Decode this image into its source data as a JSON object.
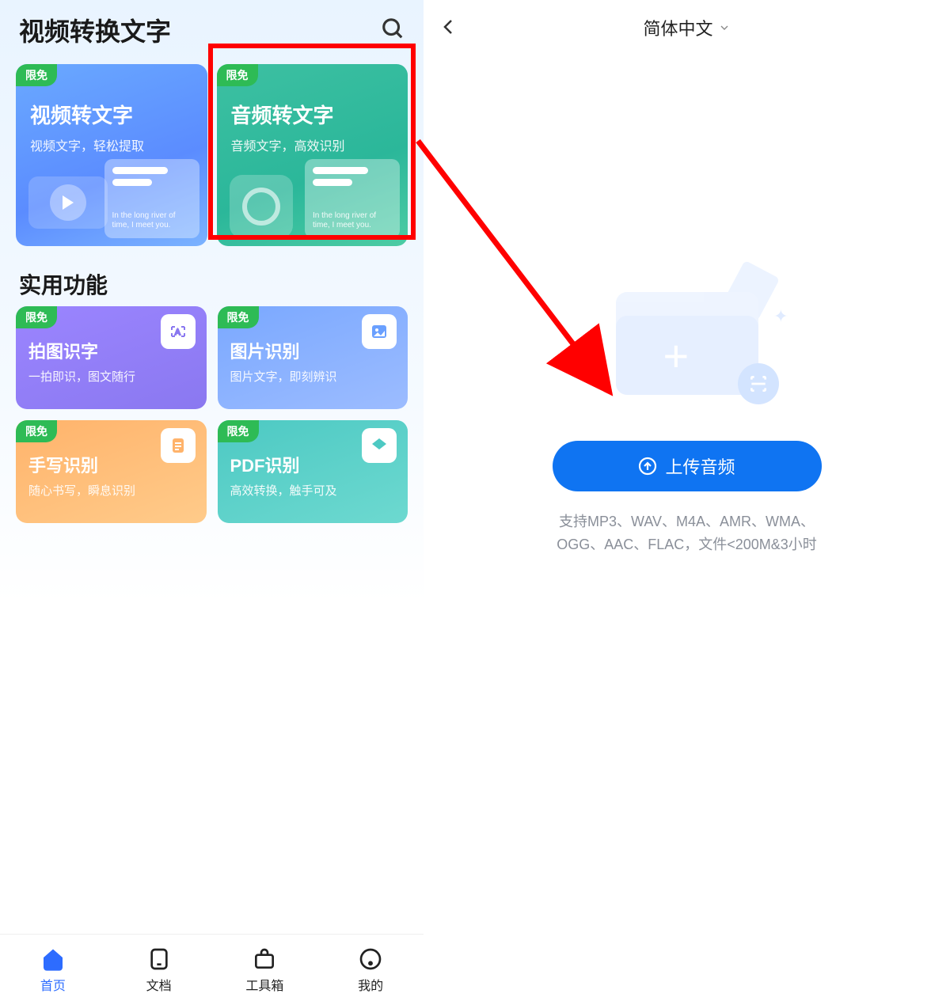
{
  "left": {
    "header": {
      "title": "视频转换文字"
    },
    "badge_label": "限免",
    "main_cards": [
      {
        "title": "视频转文字",
        "sub": "视频文字，轻松提取",
        "note_text": "In the long river of time, I meet you."
      },
      {
        "title": "音频转文字",
        "sub": "音频文字，高效识别",
        "note_text": "In the long river of time, I meet you."
      }
    ],
    "section_title": "实用功能",
    "util_cards": [
      {
        "title": "拍图识字",
        "sub": "一拍即识，图文随行"
      },
      {
        "title": "图片识别",
        "sub": "图片文字，即刻辨识"
      },
      {
        "title": "手写识别",
        "sub": "随心书写，瞬息识别"
      },
      {
        "title": "PDF识别",
        "sub": "高效转换，触手可及"
      }
    ],
    "tabs": [
      {
        "label": "首页"
      },
      {
        "label": "文档"
      },
      {
        "label": "工具箱"
      },
      {
        "label": "我的"
      }
    ]
  },
  "right": {
    "language": "简体中文",
    "upload_label": "上传音频",
    "support_text": "支持MP3、WAV、M4A、AMR、WMA、OGG、AAC、FLAC，文件<200M&3小时"
  }
}
